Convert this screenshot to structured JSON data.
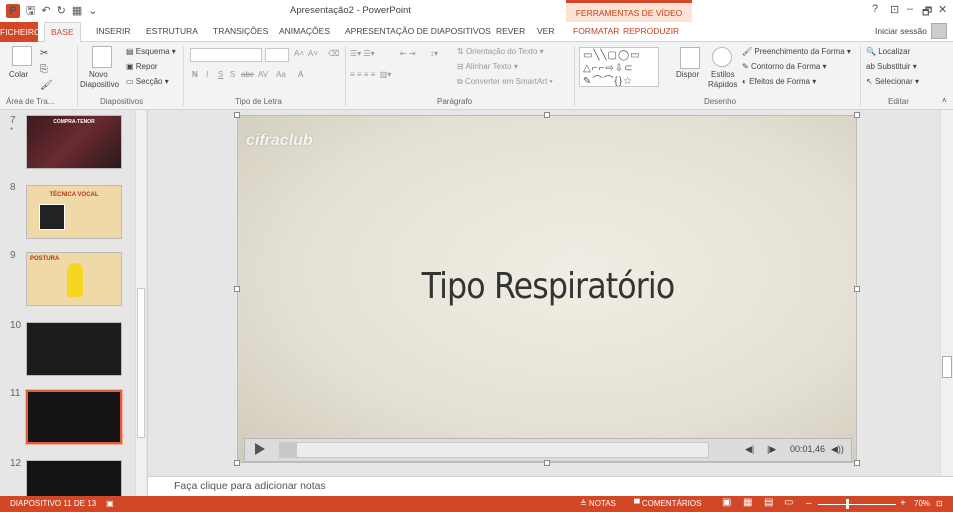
{
  "window": {
    "title": "Apresentação2 - PowerPoint",
    "context_group": "FERRAMENTAS DE VÍDEO",
    "help": "?",
    "minimize": "–",
    "maximize": "🗗",
    "close": "✕",
    "ribbon_display": "⊡"
  },
  "tabs": [
    "FICHEIRO",
    "BASE",
    "INSERIR",
    "ESTRUTURA",
    "TRANSIÇÕES",
    "ANIMAÇÕES",
    "APRESENTAÇÃO DE DIAPOSITIVOS",
    "REVER",
    "VER",
    "FORMATAR",
    "REPRODUZIR"
  ],
  "signin": "Iniciar sessão",
  "ribbon": {
    "clipboard": {
      "paste": "Colar",
      "label": "Área de Tra..."
    },
    "slides": {
      "new_slide": "Novo",
      "new_slide2": "Diapositivo",
      "layout": "Esquema",
      "reset": "Repor",
      "section": "Secção",
      "label": "Diapositivos"
    },
    "font": {
      "label": "Tipo de Letra",
      "b": "N",
      "i": "I",
      "u": "S",
      "s": "S",
      "strike": "abc",
      "spacing": "AV",
      "case": "Aa",
      "color": "A",
      "grow": "A",
      "shrink": "A"
    },
    "paragraph": {
      "text_direction": "Orientação do Texto",
      "align_text": "Alinhar Texto",
      "smartart": "Converter em SmartArt",
      "label": "Parágrafo"
    },
    "drawing": {
      "arrange": "Dispor",
      "quick_styles": "Estilos",
      "quick_styles2": "Rápidos",
      "fill": "Preenchimento da Forma",
      "outline": "Contorno da Forma",
      "effects": "Efeitos de Forma",
      "label": "Desenho",
      "shapes": "▭╲╲▢◯▭ △⌐⌐⇨⇩⊂ ✎⌒⌒{}☆"
    },
    "editing": {
      "find": "Localizar",
      "replace": "Substituir",
      "select": "Selecionar",
      "label": "Editar"
    }
  },
  "thumbnails": [
    {
      "num": "7",
      "text": "COMPRA-TENOR",
      "style": "dark-photo",
      "star": "*"
    },
    {
      "num": "8",
      "text": "TÉCNICA VOCAL",
      "style": "beige-photo"
    },
    {
      "num": "9",
      "text": "POSTURA",
      "style": "beige-minion"
    },
    {
      "num": "10",
      "text": "",
      "style": "black"
    },
    {
      "num": "11",
      "text": "",
      "style": "black-selected"
    },
    {
      "num": "12",
      "text": "",
      "style": "black"
    }
  ],
  "slide": {
    "logo": "cifraclub",
    "title": "Tipo Respiratório"
  },
  "player": {
    "time": "00:01,46",
    "progress": 0.04,
    "back": "◀|",
    "forward": "|▶",
    "volume": "◀))"
  },
  "notes": "Faça clique para adicionar notas",
  "status": {
    "slide_info": "DIAPOSITIVO 11 DE 13",
    "notes_btn": "≜ NOTAS",
    "comments_btn": "▀ COMENTÁRIOS",
    "zoom": "70%"
  }
}
